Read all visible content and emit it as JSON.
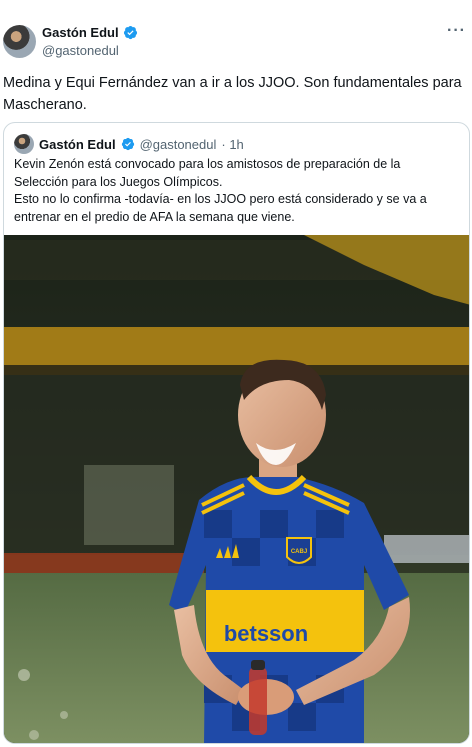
{
  "tweet": {
    "author_name": "Gastón Edul",
    "author_handle": "@gastonedul",
    "more_icon": "more-icon",
    "text": "Medina y Equi Fernández van a ir a los JJOO. Son fundamentales para Mascherano."
  },
  "quote": {
    "author_name": "Gastón Edul",
    "author_handle": "@gastonedul",
    "time": "· 1h",
    "lines": [
      "Kevin Zenón está convocado para los amistosos de preparación de la",
      "Selección para los Juegos Olímpicos.",
      "Esto no lo confirma -todavía- en los JJOO pero está considerado y se va a",
      "entrenar en el predio de AFA la semana que viene."
    ]
  },
  "photo": {
    "shirt_sponsor": "betsson",
    "badge_text": "CABJ"
  },
  "colors": {
    "verified": "#1d9bf0",
    "text": "#0f1419",
    "secondary": "#536471",
    "border": "#cfd9de",
    "shirt_blue": "#1f4aa8",
    "shirt_yellow": "#f4c20d"
  }
}
